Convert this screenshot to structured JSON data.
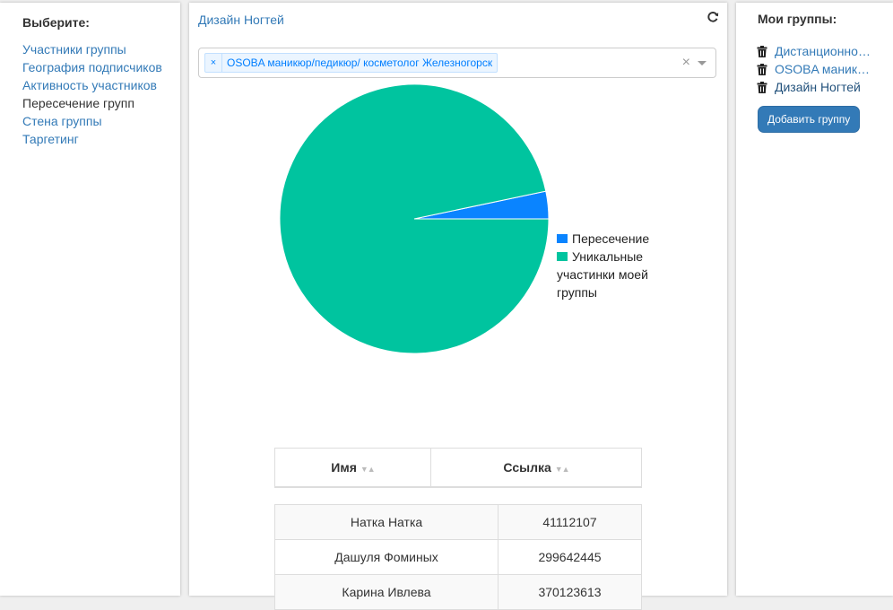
{
  "left": {
    "heading": "Выберите:",
    "items": [
      {
        "label": "Участники группы",
        "active": false
      },
      {
        "label": "География подписчиков",
        "active": false
      },
      {
        "label": "Активность участников",
        "active": false
      },
      {
        "label": "Пересечение групп",
        "active": true
      },
      {
        "label": "Стена группы",
        "active": false
      },
      {
        "label": "Таргетинг",
        "active": false
      }
    ]
  },
  "center": {
    "group_title": "Дизайн Ногтей",
    "refresh_icon": "refresh-icon",
    "select": {
      "tag_label": "OSOBA маникюр/педикюр/ косметолог Железногорск",
      "tag_remove": "×",
      "clear": "×"
    },
    "table": {
      "headers": [
        "Имя",
        "Ссылка"
      ],
      "sort_glyph": "▼▲",
      "rows": [
        [
          "Натка Натка",
          "41112107"
        ],
        [
          "Дашуля Фоминых",
          "299642445"
        ],
        [
          "Карина Ивлева",
          "370123613"
        ]
      ]
    }
  },
  "chart_data": {
    "type": "pie",
    "series": [
      {
        "name": "Пересечение",
        "value": 3.3,
        "color": "#0a84ff"
      },
      {
        "name": "Уникальные участинки моей группы",
        "value": 96.7,
        "color": "#00c49f"
      }
    ],
    "legend_placement": "right",
    "legend": {
      "intersection": "Пересечение",
      "unique_lines": [
        "Уникальные",
        "участинки моей",
        "группы"
      ]
    }
  },
  "right": {
    "heading": "Мои группы:",
    "groups": [
      {
        "label": "Дистанционно…",
        "icon": "trash-icon"
      },
      {
        "label": "OSOBA маник…",
        "icon": "trash-icon"
      },
      {
        "label": "Дизайн Ногтей",
        "icon": "trash-icon"
      }
    ],
    "add_button": "Добавить группу"
  },
  "colors": {
    "link": "#337ab7",
    "button": "#337ab7",
    "tag_text": "#007eff"
  }
}
